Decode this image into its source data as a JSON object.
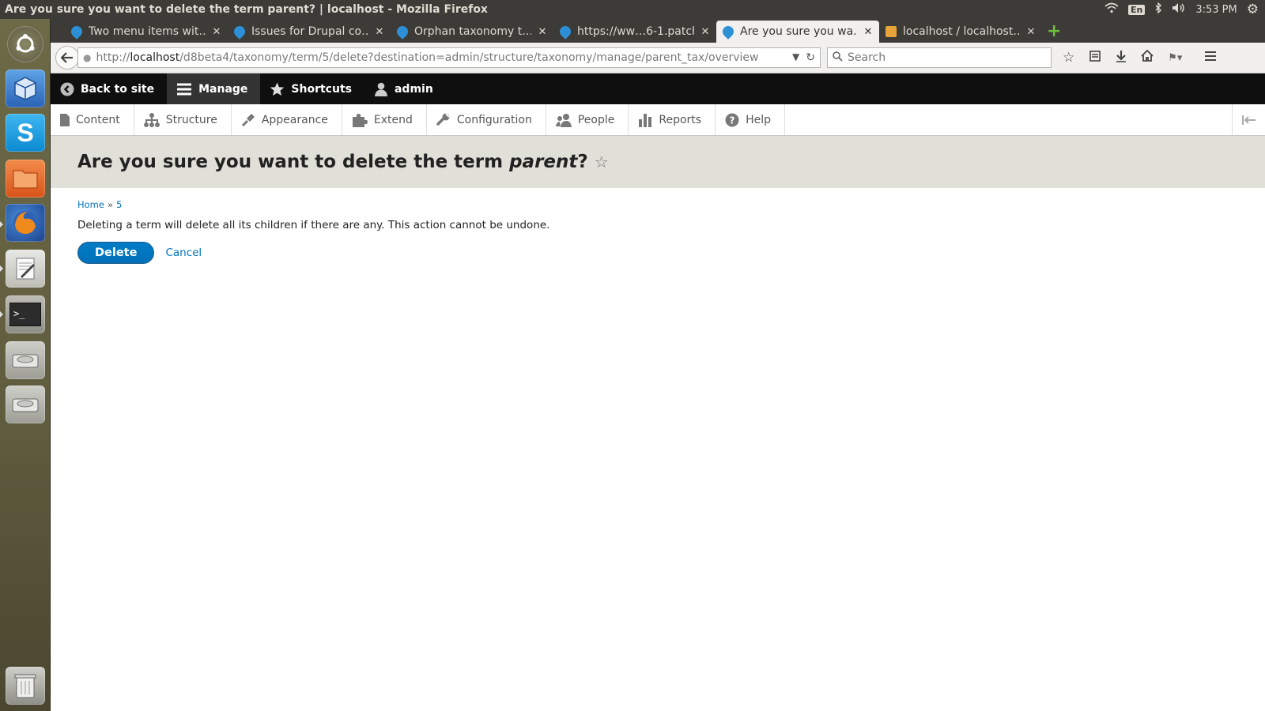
{
  "os": {
    "window_title": "Are you sure you want to delete the term parent? | localhost - Mozilla Firefox",
    "lang": "En",
    "clock": "3:53 PM"
  },
  "browser": {
    "tabs": [
      {
        "label": "Two menu items wit…",
        "active": false
      },
      {
        "label": "Issues for Drupal co…",
        "active": false
      },
      {
        "label": "Orphan taxonomy t…",
        "active": false
      },
      {
        "label": "https://ww…6-1.patch",
        "active": false
      },
      {
        "label": "Are you sure you wa…",
        "active": true
      },
      {
        "label": "localhost / localhost…",
        "active": false
      }
    ],
    "url_scheme": "http://",
    "url_host": "localhost",
    "url_path": "/d8beta4/taxonomy/term/5/delete?destination=admin/structure/taxonomy/manage/parent_tax/overview",
    "search_placeholder": "Search"
  },
  "toolbar": {
    "back_to_site": "Back to site",
    "manage": "Manage",
    "shortcuts": "Shortcuts",
    "user": "admin"
  },
  "menu": {
    "content": "Content",
    "structure": "Structure",
    "appearance": "Appearance",
    "extend": "Extend",
    "configuration": "Configuration",
    "people": "People",
    "reports": "Reports",
    "help": "Help"
  },
  "page": {
    "title_prefix": "Are you sure you want to delete the term ",
    "title_term": "parent",
    "title_suffix": "?",
    "breadcrumb": [
      "Home",
      "5"
    ],
    "breadcrumb_sep": "»",
    "description": "Deleting a term will delete all its children if there are any. This action cannot be undone.",
    "delete_label": "Delete",
    "cancel_label": "Cancel"
  },
  "colors": {
    "accent": "#0074bd",
    "toolbar_bg": "#0f0f0f",
    "header_bg": "#e0e0d8"
  }
}
